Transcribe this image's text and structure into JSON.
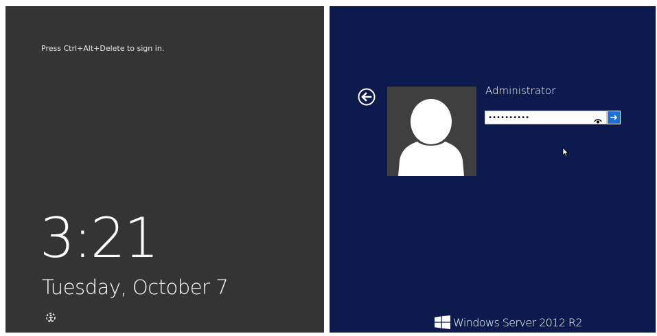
{
  "lock_screen": {
    "hint": "Press Ctrl+Alt+Delete to sign in.",
    "time": "3:21",
    "date": "Tuesday, October 7",
    "ease_of_access_icon": "ease-of-access-icon"
  },
  "signin": {
    "username": "Administrator",
    "password_value": "••••••••••",
    "back_icon": "back-arrow-icon",
    "avatar_icon": "user-avatar-icon",
    "reveal_icon": "password-reveal-icon",
    "submit_icon": "arrow-right-icon"
  },
  "branding": {
    "product_name": "Windows Server 2012 R2",
    "logo_icon": "windows-logo-icon"
  },
  "colors": {
    "lock_background": "#343434",
    "signin_background": "#0c1a4e",
    "avatar_background": "#3f3f3f",
    "submit_accent": "#1e6fd6"
  }
}
